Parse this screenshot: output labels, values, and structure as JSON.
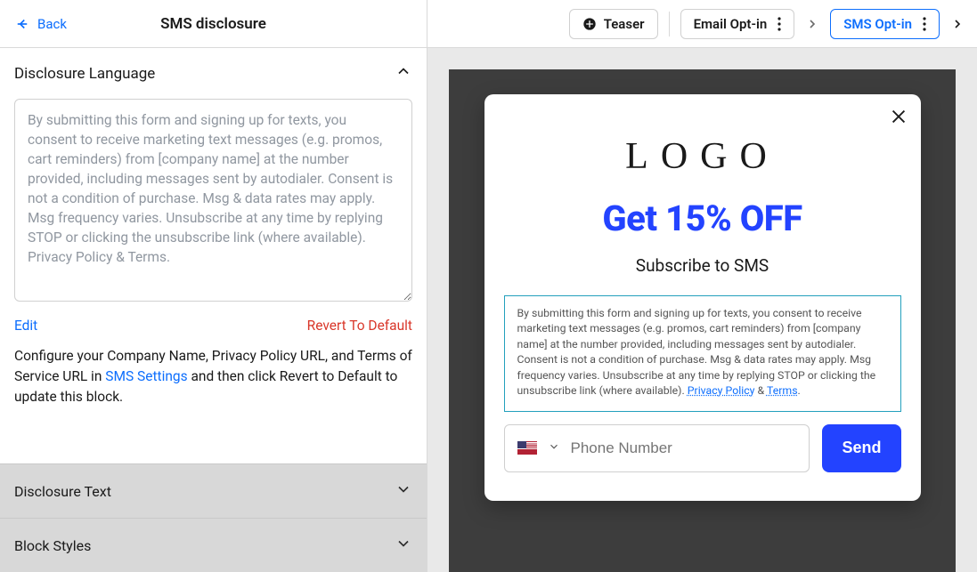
{
  "topbar": {
    "back_label": "Back",
    "title": "SMS disclosure",
    "steps": {
      "teaser": "Teaser",
      "email_optin": "Email Opt-in",
      "sms_optin": "SMS Opt-in"
    }
  },
  "left": {
    "section_title": "Disclosure Language",
    "textarea_value": "By submitting this form and signing up for texts, you consent to receive marketing text messages (e.g. promos, cart reminders) from [company name] at the number provided, including messages sent by autodialer. Consent is not a condition of purchase. Msg & data rates may apply. Msg frequency varies. Unsubscribe at any time by replying STOP or clicking the unsubscribe link (where available). Privacy Policy & Terms.",
    "edit_label": "Edit",
    "revert_label": "Revert To Default",
    "help_text_1": "Configure your Company Name, Privacy Policy URL, and Terms of Service URL in ",
    "help_link": "SMS Settings",
    "help_text_2": " and then click Revert to Default to update this block.",
    "collapsed": {
      "disclosure_text": "Disclosure Text",
      "block_styles": "Block Styles"
    }
  },
  "preview": {
    "logo_text": "LOGO",
    "headline": "Get 15% OFF",
    "sub": "Subscribe to SMS",
    "disclosure_prefix": "By submitting this form and signing up for texts, you consent to receive marketing text messages (e.g. promos, cart reminders) from [company name] at the number provided, including messages sent by autodialer. Consent is not a condition of purchase. Msg & data rates may apply. Msg frequency varies. Unsubscribe at any time by replying STOP or clicking the unsubscribe link (where available). ",
    "privacy_label": "Privacy Policy",
    "amp": " & ",
    "terms_label": "Terms",
    "period": ".",
    "phone_placeholder": "Phone Number",
    "send_label": "Send"
  }
}
